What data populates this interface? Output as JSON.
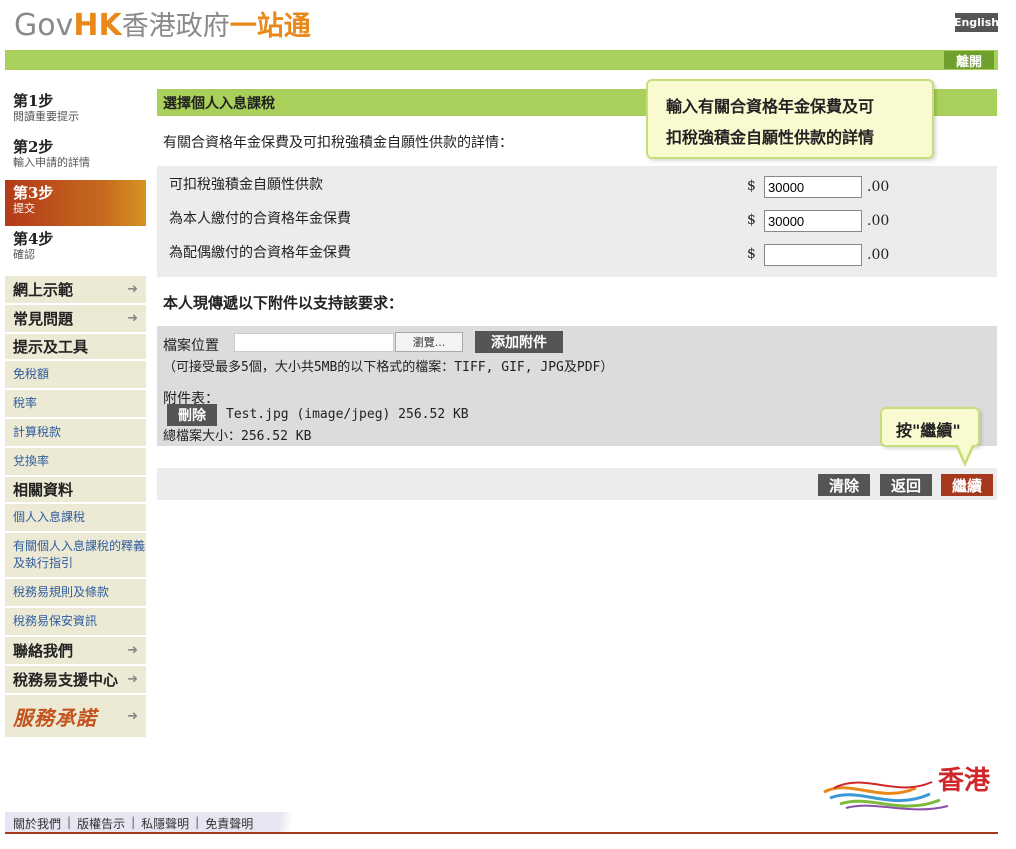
{
  "header": {
    "logo_gov": "Gov",
    "logo_hk": "HK",
    "logo_cn_grey": "香港政府",
    "logo_cn_orange": "一站通",
    "lang_button": "English",
    "exit_button": "離開"
  },
  "steps": [
    {
      "title": "第1步",
      "subtitle": "閱讀重要提示"
    },
    {
      "title": "第2步",
      "subtitle": "輸入申請的詳情"
    },
    {
      "title": "第3步",
      "subtitle": "提交"
    },
    {
      "title": "第4步",
      "subtitle": "確認"
    }
  ],
  "sidebar": {
    "online_demo": "網上示範",
    "faq": "常見問題",
    "tips_tools": "提示及工具",
    "tools": [
      "免稅額",
      "稅率",
      "計算稅款",
      "兌換率"
    ],
    "related": "相關資料",
    "related_links": [
      "個人入息課稅",
      "有關個人入息課稅的釋義及執行指引",
      "稅務易規則及條款",
      "稅務易保安資訊"
    ],
    "contact": "聯絡我們",
    "support": "稅務易支援中心",
    "brand": "服務承諾"
  },
  "main": {
    "section_title": "選擇個人入息課稅",
    "intro": "有關合資格年金保費及可扣稅強積金自願性供款的詳情：",
    "currency": "$",
    "cents": ".00",
    "rows": [
      {
        "label": "可扣稅強積金自願性供款",
        "value": "30000"
      },
      {
        "label": "為本人繳付的合資格年金保費",
        "value": "30000"
      },
      {
        "label": "為配偶繳付的合資格年金保費",
        "value": ""
      }
    ],
    "attach_title": "本人現傳遞以下附件以支持該要求：",
    "file_label": "檔案位置",
    "browse_label": "瀏覽...",
    "add_label": "添加附件",
    "accept_note": "（可接受最多5個，大小共5MB的以下格式的檔案：TIFF, GIF, JPG及PDF）",
    "list_label": "附件表：",
    "delete_label": "刪除",
    "file_entry": "Test.jpg (image/jpeg) 256.52 KB",
    "total_size": "總檔案大小：256.52 KB",
    "clear_label": "清除",
    "back_label": "返回",
    "continue_label": "繼續"
  },
  "tooltips": {
    "tip1_line1": "輸入有關合資格年金保費及可",
    "tip1_line2": "扣稅強積金自願性供款的詳情",
    "tip2": "按\"繼續\""
  },
  "footer": {
    "links": [
      "關於我們",
      "版權告示",
      "私隱聲明",
      "免責聲明"
    ],
    "separator": "|",
    "brand": "香港"
  },
  "colors": {
    "green": "#a8d05a",
    "accent": "#a6381e",
    "orange": "#e8891a",
    "link": "#2f5d9f"
  }
}
